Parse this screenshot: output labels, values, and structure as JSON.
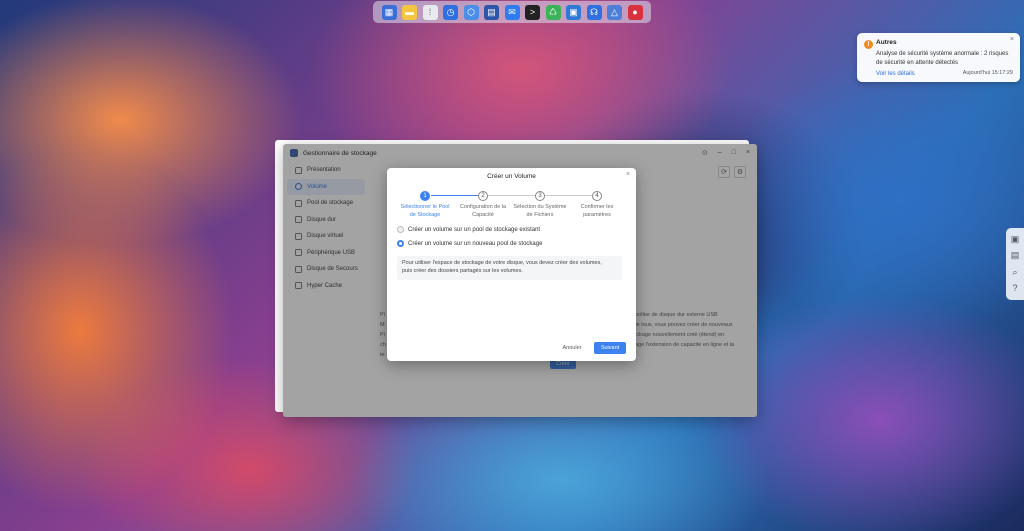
{
  "dock": {
    "icons": [
      {
        "name": "app-grid-icon",
        "color": "#3b6fd8",
        "glyph": "▦"
      },
      {
        "name": "notes-icon",
        "color": "#f5c542",
        "glyph": "▬"
      },
      {
        "name": "apps-icon",
        "color": "#e7e9ee",
        "glyph": "⁞"
      },
      {
        "name": "clock-icon",
        "color": "#2f6fe0",
        "glyph": "◷"
      },
      {
        "name": "settings-hex-icon",
        "color": "#4a8ee8",
        "glyph": "⬡"
      },
      {
        "name": "storage-icon",
        "color": "#2f55a8",
        "glyph": "▤"
      },
      {
        "name": "mail-icon",
        "color": "#2e7cf0",
        "glyph": "✉"
      },
      {
        "name": "terminal-icon",
        "color": "#222222",
        "glyph": ">"
      },
      {
        "name": "recycle-icon",
        "color": "#3cb35a",
        "glyph": "♺"
      },
      {
        "name": "package-icon",
        "color": "#2f7ad8",
        "glyph": "▣"
      },
      {
        "name": "support-icon",
        "color": "#2f6fe0",
        "glyph": "☊"
      },
      {
        "name": "triangle-app-icon",
        "color": "#4d7fd8",
        "glyph": "△"
      },
      {
        "name": "raspberry-icon",
        "color": "#d8323f",
        "glyph": "●"
      }
    ]
  },
  "notification": {
    "title": "Autres",
    "message": "Analyse de sécurité système anormale : 2 risques de sécurité en attente détectés",
    "link": "Voir les détails",
    "time": "Aujourd'hui 15:17:29",
    "close": "×"
  },
  "side_tools": [
    "▣",
    "▤",
    "⌕",
    "?"
  ],
  "window": {
    "title": "Gestionnaire de stockage",
    "controls": [
      "⊙",
      "–",
      "□",
      "×"
    ],
    "sidebar": [
      {
        "label": "Présentation",
        "active": false
      },
      {
        "label": "Volume",
        "active": true
      },
      {
        "label": "Pool de stockage",
        "active": false
      },
      {
        "label": "Disque dur",
        "active": false
      },
      {
        "label": "Disque virtuel",
        "active": false
      },
      {
        "label": "Périphérique USB",
        "active": false
      },
      {
        "label": "Disque de Secours",
        "active": false
      },
      {
        "label": "Hyper Cache",
        "active": false
      }
    ],
    "bg_text_left": [
      "Pi",
      "M",
      "Pi",
      "ch",
      "te"
    ],
    "bg_text_right": [
      "le boîtier de disque dur externe USB",
      "d de tous, vous pouvez créer de nouveaux",
      "stockage nouvellement créé (étend) en",
      "lorage l'extension de capacité en ligne et la"
    ],
    "create_label": "Créer"
  },
  "dialog": {
    "title": "Créer un Volume",
    "close": "×",
    "steps": [
      {
        "num": "1",
        "label_lines": [
          "Sélectionner le Pool",
          "de Stockage"
        ],
        "active": true
      },
      {
        "num": "2",
        "label_lines": [
          "Configuration de la",
          "Capacité"
        ],
        "active": false
      },
      {
        "num": "3",
        "label_lines": [
          "Sélection du Système",
          "de Fichiers"
        ],
        "active": false
      },
      {
        "num": "4",
        "label_lines": [
          "Confirmer les",
          "paramètres"
        ],
        "active": false
      }
    ],
    "option_existing": "Créer un volume sur un pool de stockage existant",
    "option_new": "Créer un volume sur un nouveau pool de stockage",
    "info_line1": "Pour utiliser l'espace de stockage de votre disque, vous devez créer des volumes,",
    "info_line2": "puis créer des dossiers partagés sur les volumes.",
    "cancel_label": "Annuler",
    "next_label": "Suivant"
  }
}
